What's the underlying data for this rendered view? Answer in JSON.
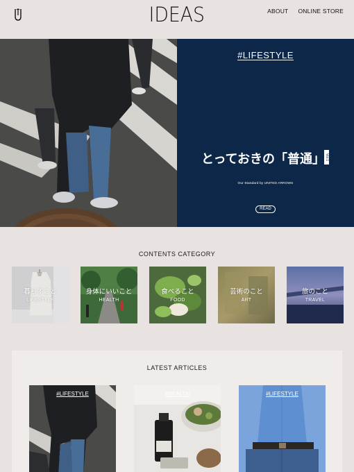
{
  "header": {
    "brand": "IDEAS",
    "logo_icon": "ua-logo-icon",
    "nav": [
      {
        "label": "ABOUT"
      },
      {
        "label": "ONLINE STORE"
      }
    ]
  },
  "hero": {
    "tag": "#LIFESTYLE",
    "title": "とっておきの「普通」",
    "vol": "Vol.1",
    "subtitle": "Our Standard by UNITED ARROWS",
    "read_label": "READ",
    "panel_color": "#0c2748"
  },
  "categories": {
    "heading": "CONTENTS CATEGORY",
    "items": [
      {
        "jp": "暮らすこと",
        "en": "LIFESTYLE"
      },
      {
        "jp": "身体にいいこと",
        "en": "HEALTH"
      },
      {
        "jp": "食べること",
        "en": "FOOD"
      },
      {
        "jp": "芸術のこと",
        "en": "ART"
      },
      {
        "jp": "旅のこと",
        "en": "TRAVEL"
      }
    ]
  },
  "latest": {
    "heading": "LATEST ARTICLES",
    "articles": [
      {
        "tag": "#LIFESTYLE"
      },
      {
        "tag": "#HEALTH"
      },
      {
        "tag": "#LIFESTYLE"
      }
    ]
  }
}
